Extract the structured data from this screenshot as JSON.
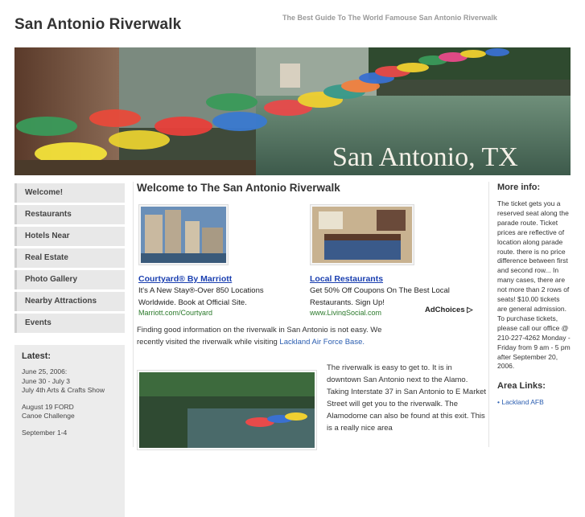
{
  "site": {
    "title": "San Antonio Riverwalk",
    "tagline": "The Best Guide To The World Famouse San Antonio Riverwalk",
    "banner_caption": "San Antonio, TX"
  },
  "nav": {
    "items": [
      {
        "label": "Welcome!"
      },
      {
        "label": "Restaurants"
      },
      {
        "label": "Hotels Near"
      },
      {
        "label": "Real Estate"
      },
      {
        "label": "Photo Gallery"
      },
      {
        "label": "Nearby Attractions"
      },
      {
        "label": "Events"
      }
    ]
  },
  "latest": {
    "heading": "Latest:",
    "entries": [
      {
        "text": "June 25, 2006:\nJune 30 - July 3\nJuly 4th Arts & Crafts Show"
      },
      {
        "text": "August 19 FORD\nCanoe Challenge"
      },
      {
        "text": "September 1-4"
      }
    ]
  },
  "main": {
    "heading": "Welcome to The San Antonio Riverwalk",
    "ads": [
      {
        "title": "Courtyard® By Marriott",
        "desc": "It's A New Stay®-Over 850 Locations Worldwide. Book at Official Site.",
        "url": "Marriott.com/Courtyard"
      },
      {
        "title": "Local Restaurants",
        "desc": "Get 50% Off Coupons On The Best Local Restaurants. Sign Up!",
        "url": "www.LivingSocial.com"
      }
    ],
    "adchoices": "AdChoices ▷",
    "intro_text": "Finding good information on the riverwalk in San Antonio is not easy. We recently visited the riverwalk while visiting ",
    "intro_link": "Lackland Air Force Base.",
    "river_text": "The riverwalk is easy to get to. It is in downtown San Antonio next to the Alamo. Taking Interstate 37 in San Antonio to E Market Street will get you to the riverwalk. The Alamodome can also be found at this exit. This is a really nice area"
  },
  "more_info": {
    "heading": "More info:",
    "text": "The ticket gets you a reserved seat along the parade route. Ticket prices are reflective of location along parade route. there is no price difference between first and second row... In many cases, there are not more than 2 rows of seats! $10.00 tickets are general admission. To purchase tickets, please call our office @ 210-227-4262 Monday - Friday from 9 am - 5 pm after September 20, 2006."
  },
  "area_links": {
    "heading": "Area Links:",
    "items": [
      {
        "label": "Lackland AFB"
      }
    ]
  },
  "colors": {
    "link": "#2a5db0",
    "ad_title": "#1a3fb0",
    "ad_url": "#2b7a2b",
    "nav_bg": "#e8e8e8"
  }
}
